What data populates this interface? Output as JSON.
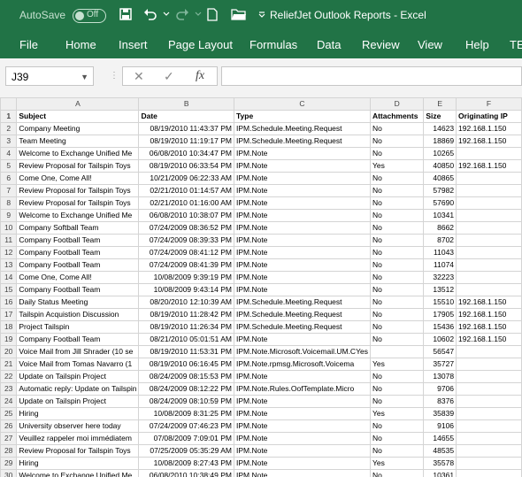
{
  "title_bar": {
    "autosave_label": "AutoSave",
    "autosave_state": "Off",
    "window_title": "ReliefJet Outlook Reports  -  Excel"
  },
  "ribbon_tabs": [
    "File",
    "Home",
    "Insert",
    "Page Layout",
    "Formulas",
    "Data",
    "Review",
    "View",
    "Help",
    "TE"
  ],
  "formula_bar": {
    "name_box": "J39",
    "fx_label": "fx",
    "formula_value": ""
  },
  "sheet": {
    "column_letters": [
      "A",
      "B",
      "C",
      "D",
      "E",
      "F"
    ],
    "rows": [
      {
        "n": "1",
        "cells": [
          "Subject",
          "Date",
          "Type",
          "Attachments",
          "Size",
          "Originating IP"
        ]
      },
      {
        "n": "2",
        "cells": [
          "Company Meeting",
          "08/19/2010 11:43:37 PM",
          "IPM.Schedule.Meeting.Request",
          "No",
          "14623",
          "192.168.1.150"
        ]
      },
      {
        "n": "3",
        "cells": [
          "Team Meeting",
          "08/19/2010 11:19:17 PM",
          "IPM.Schedule.Meeting.Request",
          "No",
          "18869",
          "192.168.1.150"
        ]
      },
      {
        "n": "4",
        "cells": [
          "Welcome to Exchange Unified Me",
          "06/08/2010 10:34:47 PM",
          "IPM.Note",
          "No",
          "10265",
          ""
        ]
      },
      {
        "n": "5",
        "cells": [
          "Review Proposal for Tailspin Toys",
          "08/19/2010 06:33:54 PM",
          "IPM.Note",
          "Yes",
          "40850",
          "192.168.1.150"
        ]
      },
      {
        "n": "6",
        "cells": [
          "Come One, Come All!",
          "10/21/2009 06:22:33 AM",
          "IPM.Note",
          "No",
          "40865",
          ""
        ]
      },
      {
        "n": "7",
        "cells": [
          "Review Proposal for Tailspin Toys",
          "02/21/2010 01:14:57 AM",
          "IPM.Note",
          "No",
          "57982",
          ""
        ]
      },
      {
        "n": "8",
        "cells": [
          "Review Proposal for Tailspin Toys",
          "02/21/2010 01:16:00 AM",
          "IPM.Note",
          "No",
          "57690",
          ""
        ]
      },
      {
        "n": "9",
        "cells": [
          "Welcome to Exchange Unified Me",
          "06/08/2010 10:38:07 PM",
          "IPM.Note",
          "No",
          "10341",
          ""
        ]
      },
      {
        "n": "10",
        "cells": [
          "Company Softball Team",
          "07/24/2009 08:36:52 PM",
          "IPM.Note",
          "No",
          "8662",
          ""
        ]
      },
      {
        "n": "11",
        "cells": [
          "Company Football Team",
          "07/24/2009 08:39:33 PM",
          "IPM.Note",
          "No",
          "8702",
          ""
        ]
      },
      {
        "n": "12",
        "cells": [
          "Company Football Team",
          "07/24/2009 08:41:12 PM",
          "IPM.Note",
          "No",
          "11043",
          ""
        ]
      },
      {
        "n": "13",
        "cells": [
          "Company Football Team",
          "07/24/2009 08:41:39 PM",
          "IPM.Note",
          "No",
          "11074",
          ""
        ]
      },
      {
        "n": "14",
        "cells": [
          "Come One, Come All!",
          "10/08/2009 9:39:19 PM",
          "IPM.Note",
          "No",
          "32223",
          ""
        ]
      },
      {
        "n": "15",
        "cells": [
          "Company Football Team",
          "10/08/2009 9:43:14 PM",
          "IPM.Note",
          "No",
          "13512",
          ""
        ]
      },
      {
        "n": "16",
        "cells": [
          "Daily Status Meeting",
          "08/20/2010 12:10:39 AM",
          "IPM.Schedule.Meeting.Request",
          "No",
          "15510",
          "192.168.1.150"
        ]
      },
      {
        "n": "17",
        "cells": [
          "Tailspin Acquistion Discussion",
          "08/19/2010 11:28:42 PM",
          "IPM.Schedule.Meeting.Request",
          "No",
          "17905",
          "192.168.1.150"
        ]
      },
      {
        "n": "18",
        "cells": [
          "Project Tailspin",
          "08/19/2010 11:26:34 PM",
          "IPM.Schedule.Meeting.Request",
          "No",
          "15436",
          "192.168.1.150"
        ]
      },
      {
        "n": "19",
        "cells": [
          "Company Football Team",
          "08/21/2010 05:01:51 AM",
          "IPM.Note",
          "No",
          "10602",
          "192.168.1.150"
        ]
      },
      {
        "n": "20",
        "cells": [
          "Voice Mail from Jill Shrader (10 se",
          "08/19/2010 11:53:31 PM",
          "IPM.Note.Microsoft.Voicemail.UM.CYes",
          "",
          "56547",
          ""
        ]
      },
      {
        "n": "21",
        "cells": [
          "Voice Mail from Tomas Navarro (1",
          "08/19/2010 06:16:45 PM",
          "IPM.Note.rpmsg.Microsoft.Voicema",
          "Yes",
          "35727",
          ""
        ]
      },
      {
        "n": "22",
        "cells": [
          "Update on Tailspin Project",
          "08/24/2009 08:15:53 PM",
          "IPM.Note",
          "No",
          "13078",
          ""
        ]
      },
      {
        "n": "23",
        "cells": [
          "Automatic reply: Update on Tailspin",
          "08/24/2009 08:12:22 PM",
          "IPM.Note.Rules.OofTemplate.Micro",
          "No",
          "9706",
          ""
        ]
      },
      {
        "n": "24",
        "cells": [
          "Update on Tailspin Project",
          "08/24/2009 08:10:59 PM",
          "IPM.Note",
          "No",
          "8376",
          ""
        ]
      },
      {
        "n": "25",
        "cells": [
          "Hiring",
          "10/08/2009 8:31:25 PM",
          "IPM.Note",
          "Yes",
          "35839",
          ""
        ]
      },
      {
        "n": "26",
        "cells": [
          "University observer here today",
          "07/24/2009 07:46:23 PM",
          "IPM.Note",
          "No",
          "9106",
          ""
        ]
      },
      {
        "n": "27",
        "cells": [
          "Veuillez rappeler moi immédiatem",
          "07/08/2009 7:09:01 PM",
          "IPM.Note",
          "No",
          "14655",
          ""
        ]
      },
      {
        "n": "28",
        "cells": [
          "Review Proposal for Tailspin Toys",
          "07/25/2009 05:35:29 AM",
          "IPM.Note",
          "No",
          "48535",
          ""
        ]
      },
      {
        "n": "29",
        "cells": [
          "Hiring",
          "10/08/2009 8:27:43 PM",
          "IPM.Note",
          "Yes",
          "35578",
          ""
        ]
      },
      {
        "n": "30",
        "cells": [
          "Welcome to Exchange Unified Me",
          "06/08/2010 10:38:49 PM",
          "IPM.Note",
          "No",
          "10361",
          ""
        ]
      }
    ]
  }
}
